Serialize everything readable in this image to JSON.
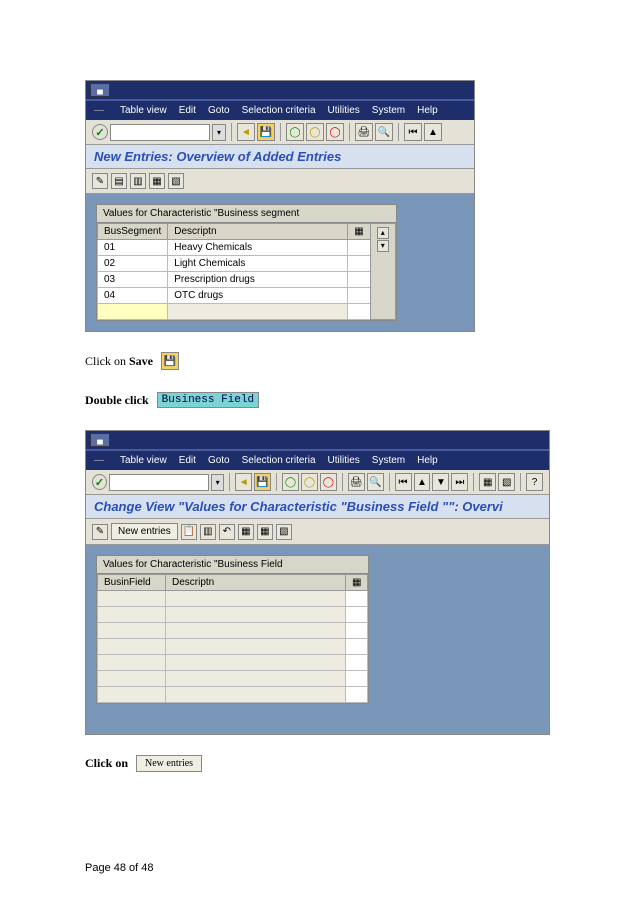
{
  "screenshot1": {
    "window_control": "▄",
    "menu": [
      "Table view",
      "Edit",
      "Goto",
      "Selection criteria",
      "Utilities",
      "System",
      "Help"
    ],
    "title": "New Entries: Overview of Added Entries",
    "panel_title": "Values for Characteristic \"Business segment",
    "columns": {
      "c1": "BusSegment",
      "c2": "Descriptn"
    },
    "rows": [
      {
        "seg": "01",
        "desc": "Heavy Chemicals"
      },
      {
        "seg": "02",
        "desc": "Light Chemicals"
      },
      {
        "seg": "03",
        "desc": "Prescription drugs"
      },
      {
        "seg": "04",
        "desc": "OTC drugs"
      }
    ]
  },
  "instruction1": {
    "pre": "Click on ",
    "bold": "Save"
  },
  "instruction2": {
    "bold": "Double click",
    "field": "Business Field"
  },
  "screenshot2": {
    "window_control": "▄",
    "menu": [
      "Table view",
      "Edit",
      "Goto",
      "Selection criteria",
      "Utilities",
      "System",
      "Help"
    ],
    "title": "Change View \"Values for Characteristic \"Business Field      \"\": Overvi",
    "new_entries_label": "New entries",
    "panel_title": "Values for Characteristic \"Business Field",
    "columns": {
      "c1": "BusinField",
      "c2": "Descriptn"
    }
  },
  "instruction3": {
    "bold": "Click on",
    "btn": "New entries"
  },
  "footer": "Page 48 of 48"
}
